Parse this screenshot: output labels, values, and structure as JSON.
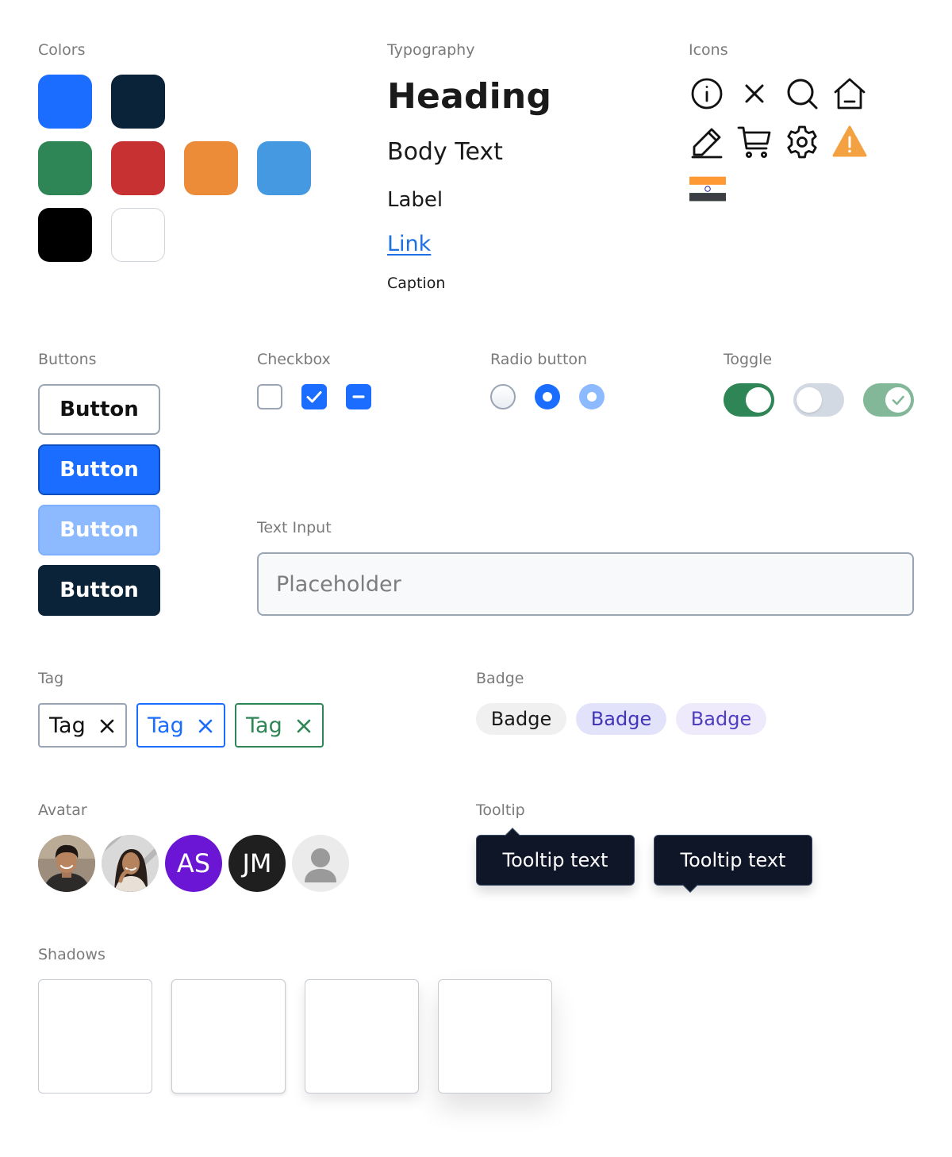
{
  "sections": {
    "colors": "Colors",
    "typography": "Typography",
    "icons": "Icons",
    "buttons": "Buttons",
    "checkbox": "Checkbox",
    "radio": "Radio button",
    "toggle": "Toggle",
    "text_input": "Text Input",
    "tag": "Tag",
    "badge": "Badge",
    "avatar": "Avatar",
    "tooltip": "Tooltip",
    "shadows": "Shadows"
  },
  "colors": {
    "primary_blue": "#1a6dff",
    "navy": "#0b2338",
    "green": "#2e8555",
    "red": "#c73132",
    "orange": "#ec8b38",
    "light_blue": "#4599e0",
    "black": "#000000",
    "white": "#ffffff"
  },
  "typography": {
    "heading": "Heading",
    "body": "Body Text",
    "label": "Label",
    "link": "Link",
    "caption": "Caption"
  },
  "icons": [
    "info-icon",
    "close-icon",
    "search-icon",
    "home-icon",
    "edit-icon",
    "cart-icon",
    "gear-icon",
    "warning-icon",
    "india-flag-icon"
  ],
  "buttons": {
    "outline": "Button",
    "primary": "Button",
    "disabled": "Button",
    "dark": "Button"
  },
  "checkboxes": [
    "unchecked",
    "checked",
    "indeterminate"
  ],
  "radios": [
    "unselected",
    "selected",
    "selected-disabled"
  ],
  "toggles": [
    "on",
    "off",
    "on-disabled"
  ],
  "text_input": {
    "placeholder": "Placeholder",
    "value": ""
  },
  "tags": [
    {
      "label": "Tag",
      "variant": "neutral"
    },
    {
      "label": "Tag",
      "variant": "blue"
    },
    {
      "label": "Tag",
      "variant": "green"
    }
  ],
  "badges": [
    {
      "label": "Badge",
      "variant": "neutral"
    },
    {
      "label": "Badge",
      "variant": "blue"
    },
    {
      "label": "Badge",
      "variant": "purple"
    }
  ],
  "avatars": [
    {
      "type": "photo"
    },
    {
      "type": "photo"
    },
    {
      "type": "initials",
      "initials": "AS",
      "color": "#6a16d4"
    },
    {
      "type": "initials",
      "initials": "JM",
      "color": "#1f1f1f"
    },
    {
      "type": "placeholder"
    }
  ],
  "tooltips": [
    {
      "text": "Tooltip text",
      "arrow": "top"
    },
    {
      "text": "Tooltip text",
      "arrow": "bottom"
    }
  ],
  "shadows": [
    "none",
    "small",
    "medium",
    "large"
  ]
}
